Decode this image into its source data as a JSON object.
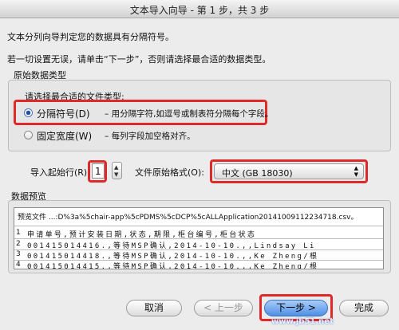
{
  "window": {
    "title": "文本导入向导 - 第 1 步，共 3 步"
  },
  "intro": {
    "line1": "文本分列向导判定您的数据具有分隔符号。",
    "line2": "若一切设置无误，请单击“下一步”，否则请选择最合适的数据类型。"
  },
  "original_type": {
    "legend": "原始数据类型",
    "prompt": "请选择最合适的文件类型:",
    "options": [
      {
        "label": "分隔符号(D)",
        "desc": "– 用分隔字符,如逗号或制表符分隔每个字段。",
        "selected": true
      },
      {
        "label": "固定宽度(W)",
        "desc": "– 每列字段加空格对齐。",
        "selected": false
      }
    ]
  },
  "start_row": {
    "label": "导入起始行(R):",
    "value": "1"
  },
  "file_origin": {
    "label": "文件原始格式(O):",
    "value": "中文 (GB 18030)"
  },
  "preview": {
    "legend": "数据预览",
    "file_label": "预览文件 ...:D%3a%5chair-app%5cPDMS%5cDCP%5cALLApplication20141009112234718.csv。",
    "rows": [
      {
        "num": "1",
        "text": "申请单号,预计安装日期,状态,期限,柜台编号,柜台状态"
      },
      {
        "num": "2",
        "text": "001415014416.,等待MSP确认,2014-10-10.,,Lindsay Li"
      },
      {
        "num": "3",
        "text": "001415014418.,等待MSP确认,2014-10-10.,,Ke Zheng/根"
      },
      {
        "num": "4",
        "text": "001415014415.,等待MSP确认,2014-10-10.,,Ke Zheng/根"
      }
    ]
  },
  "buttons": {
    "cancel": "取消",
    "back": "< 上一步",
    "next": "下一步 >",
    "finish": "完成"
  },
  "watermark": "www.jb51.net"
}
